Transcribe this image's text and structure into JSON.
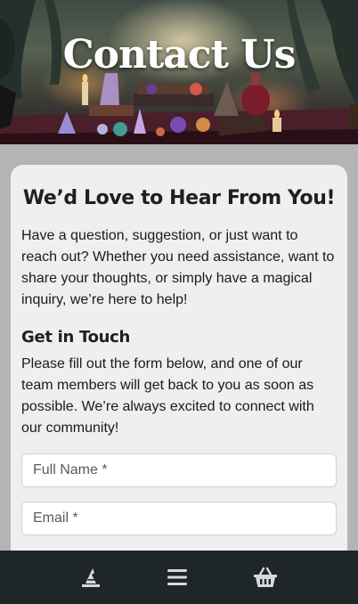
{
  "hero": {
    "title": "Contact Us"
  },
  "card": {
    "heading": "We’d Love to Hear From You!",
    "intro": "Have a question, suggestion, or just want to reach out? Whether you need assistance, want to share your thoughts, or simply have a magical inquiry, we’re here to help!",
    "get_in_touch": {
      "heading": "Get in Touch",
      "text": "Please fill out the form below, and one of our team members will get back to you as soon as possible. We’re always excited to connect with our community!"
    }
  },
  "form": {
    "full_name_placeholder": "Full Name *",
    "email_placeholder": "Email *"
  },
  "nav": {
    "items": [
      {
        "icon": "witch-hat-icon"
      },
      {
        "icon": "hamburger-menu-icon"
      },
      {
        "icon": "basket-icon"
      }
    ]
  },
  "colors": {
    "card_bg": "#efefef",
    "page_bg": "#b4b4b4",
    "nav_bg": "#1f2629",
    "nav_icon": "#d9d9d9"
  }
}
